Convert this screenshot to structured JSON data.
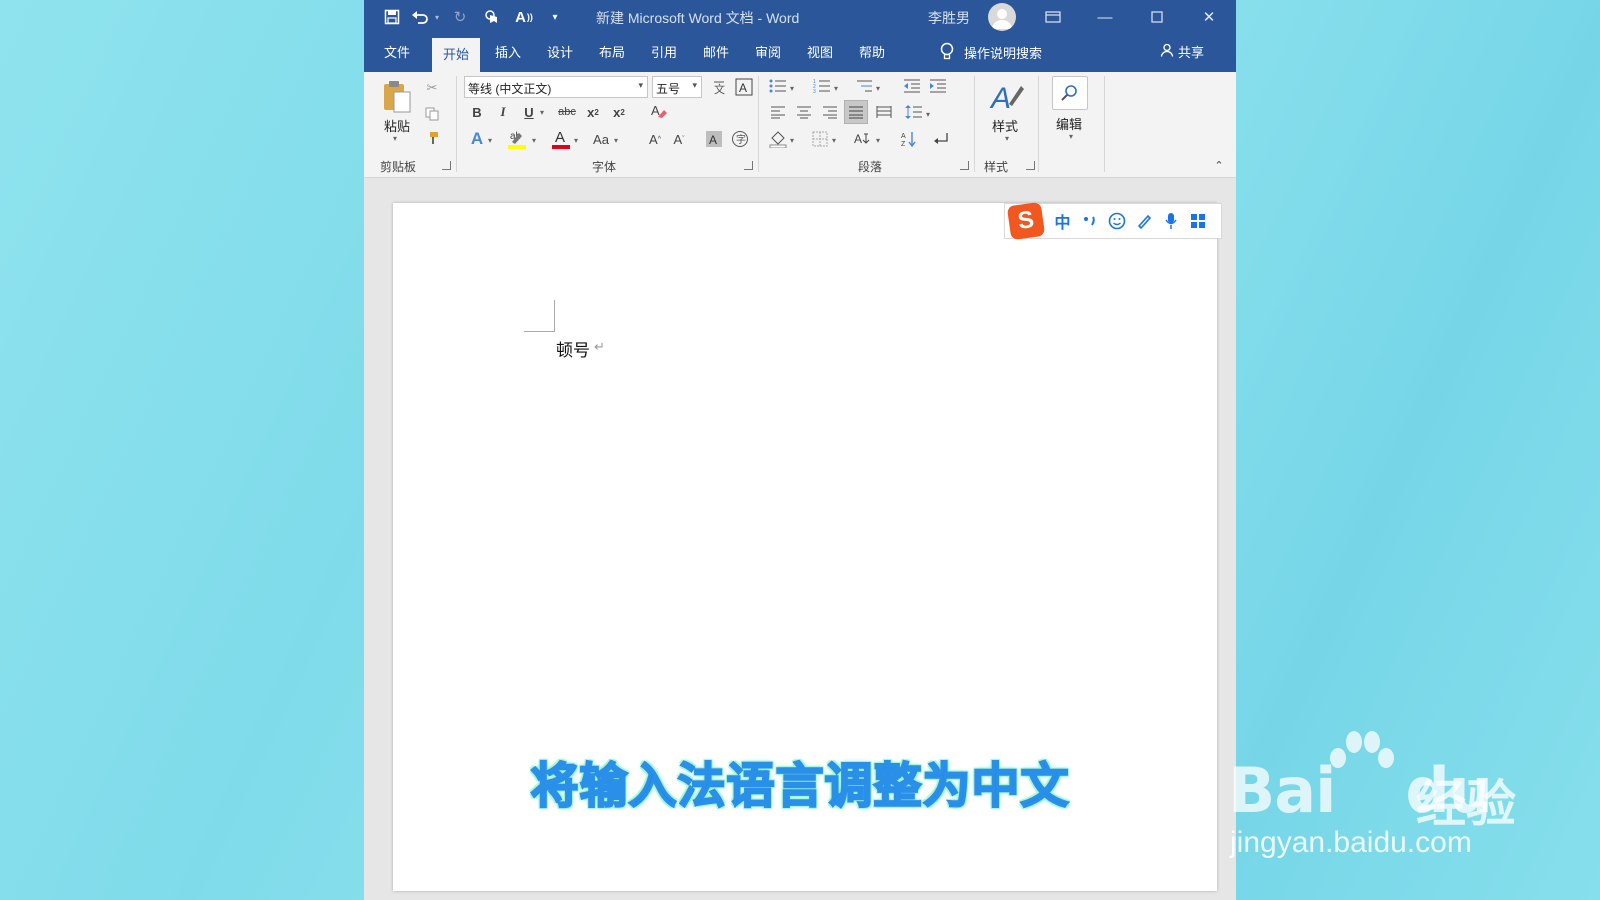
{
  "titlebar": {
    "title": "新建 Microsoft Word 文档  -  Word",
    "user": "李胜男",
    "quick_access": [
      "save-icon",
      "undo-icon",
      "redo-icon",
      "touch-mode-icon",
      "read-aloud-icon",
      "customize-icon"
    ]
  },
  "menu": {
    "tabs": [
      "文件",
      "开始",
      "插入",
      "设计",
      "布局",
      "引用",
      "邮件",
      "审阅",
      "视图",
      "帮助"
    ],
    "active_tab": "开始",
    "tell_me": "操作说明搜索",
    "share": "共享"
  },
  "ribbon": {
    "clipboard": {
      "paste_label": "粘贴",
      "group_label": "剪贴板"
    },
    "font": {
      "font_name": "等线 (中文正文)",
      "font_size": "五号",
      "group_label": "字体"
    },
    "paragraph": {
      "group_label": "段落"
    },
    "styles": {
      "styles_label": "样式",
      "group_label": "样式"
    },
    "editing": {
      "editing_label": "编辑"
    }
  },
  "ime_toolbar": {
    "logo": "S",
    "mode": "中",
    "items": [
      "punctuation-icon",
      "emoji-icon",
      "skin-icon",
      "voice-icon",
      "toolbox-icon"
    ]
  },
  "document": {
    "text": "顿号",
    "para_mark": "↵"
  },
  "caption": "将输入法语言调整为中文",
  "watermark": {
    "logo_left": "Bai",
    "logo_right": "du",
    "cn": "经验",
    "url": "jingyan.baidu.com"
  },
  "colors": {
    "title_bar": "#2b579a",
    "caption_fill": "#1a7fe0",
    "caption_glow": "#9ff5d5",
    "ime_logo": "#f2571f",
    "font_color_bar": "#e0001b",
    "highlight_bar": "#ffff00"
  }
}
